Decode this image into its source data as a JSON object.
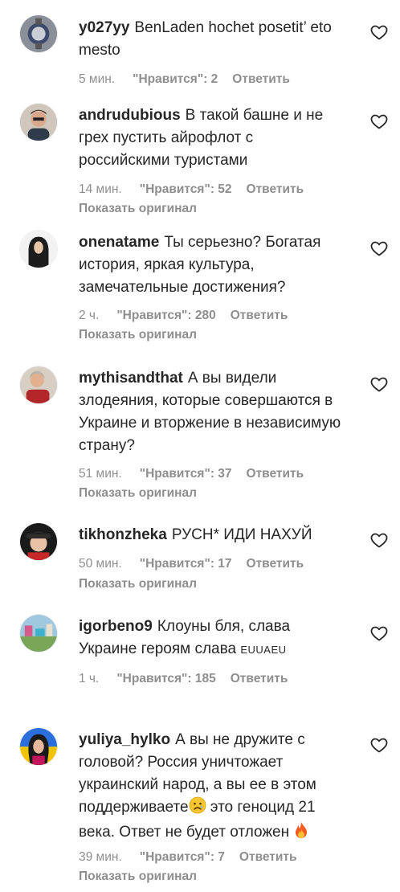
{
  "icons": {
    "like": "heart-outline-icon"
  },
  "colors": {
    "text": "#262626",
    "secondary": "#8e8e8e",
    "background": "#ffffff"
  },
  "comments": [
    {
      "username": "y027yy",
      "text": "BenLaden hochet posetit’ eto mesto",
      "time": "5 мин.",
      "likes": "\"Нравится\": 2",
      "reply": "Ответить"
    },
    {
      "username": "andrudubious",
      "text": "В такой башне и не грех пустить айрофлот с российскими туристами",
      "time": "14 мин.",
      "likes": "\"Нравится\": 52",
      "reply": "Ответить",
      "show_original": "Показать оригинал"
    },
    {
      "username": "onenatame",
      "text": "Ты серьезно? Богатая история, яркая культура, замечательные достижения?",
      "time": "2 ч.",
      "likes": "\"Нравится\": 280",
      "reply": "Ответить",
      "show_original": "Показать оригинал"
    },
    {
      "username": "mythisandthat",
      "text": "А вы видели злодеяния, которые совершаются в Украине и вторжение в независимую страну?",
      "time": "51 мин.",
      "likes": "\"Нравится\": 37",
      "reply": "Ответить",
      "show_original": "Показать оригинал"
    },
    {
      "username": "tikhonzheka",
      "text": "РУСН* ИДИ НАХУЙ",
      "time": "50 мин.",
      "likes": "\"Нравится\": 17",
      "reply": "Ответить",
      "show_original": "Показать оригинал"
    },
    {
      "username": "igorbeno9",
      "text": "Клоуны бля, слава Украине героям слава",
      "flags_text": "EUUAEU",
      "time": "1 ч.",
      "likes": "\"Нравится\": 185",
      "reply": "Ответить"
    },
    {
      "username": "yuliya_hylko",
      "text_before": "А вы не дружите с головой? Россия уничтожает украинский народ, а вы ее в этом поддерживаете",
      "text_middle": " это геноцид 21 века. Ответ не будет отложен ",
      "time": "39 мин.",
      "likes": "\"Нравится\": 7",
      "reply": "Ответить",
      "show_original": "Показать оригинал"
    }
  ]
}
